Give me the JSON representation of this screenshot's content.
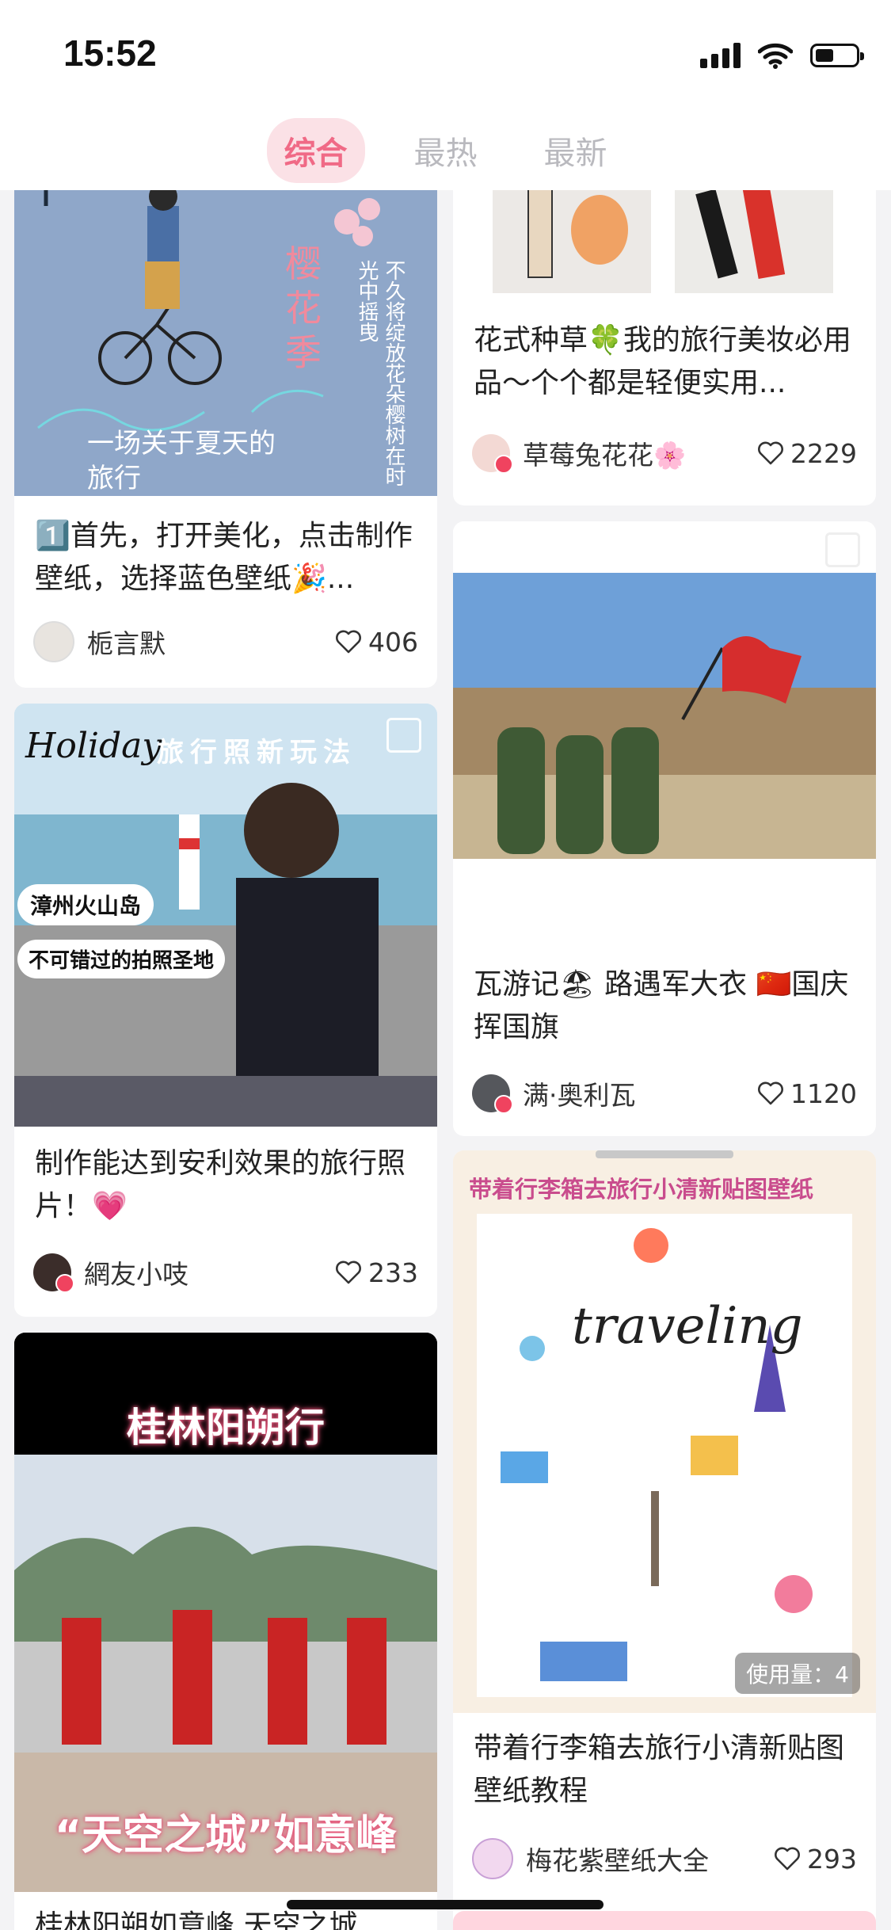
{
  "status": {
    "time": "15:52"
  },
  "tabs": [
    {
      "label": "综合",
      "active": true
    },
    {
      "label": "最热",
      "active": false
    },
    {
      "label": "最新",
      "active": false
    }
  ],
  "colors": {
    "accent": "#f06a86",
    "tab_active_bg": "#fbe1e6",
    "verified": "#f0435f"
  },
  "posts": [
    {
      "title": "1️⃣首先，打开美化，点击制作壁纸，选择蓝色壁纸🎉...",
      "author": "栀言默",
      "likes": "406",
      "image_text": {
        "vertical_title": "樱花季",
        "vertical_poem": "不久将绽放花朵樱树在时光中摇曳",
        "caption": "一场关于夏天的旅行"
      }
    },
    {
      "title": "花式种草🍀我的旅行美妆必用品～个个都是轻便实用...",
      "author": "草莓兔花花🌸",
      "likes": "2229"
    },
    {
      "title": "制作能达到安利效果的旅行照片！💗",
      "author": "網友小吱",
      "likes": "233",
      "image_text": {
        "script": "Holiday",
        "banner": "旅行照新玩法",
        "tag1": "漳州火山岛",
        "tag2": "不可错过的拍照圣地"
      }
    },
    {
      "title": "瓦游记🏖 路遇军大衣 🇨🇳国庆挥国旗",
      "author": "满·奥利瓦",
      "likes": "1120"
    },
    {
      "title": "桂林阳朔如意峰 天空之城",
      "author": "",
      "likes": "",
      "image_text": {
        "top": "桂林阳朔行",
        "bottom": "“天空之城”如意峰"
      }
    },
    {
      "title": "带着行李箱去旅行小清新贴图壁纸教程",
      "author": "梅花紫壁纸大全",
      "likes": "293",
      "image_text": {
        "header": "带着行李箱去旅行小清新贴图壁纸",
        "script": "traveling",
        "usage": "使用量：4"
      }
    }
  ]
}
